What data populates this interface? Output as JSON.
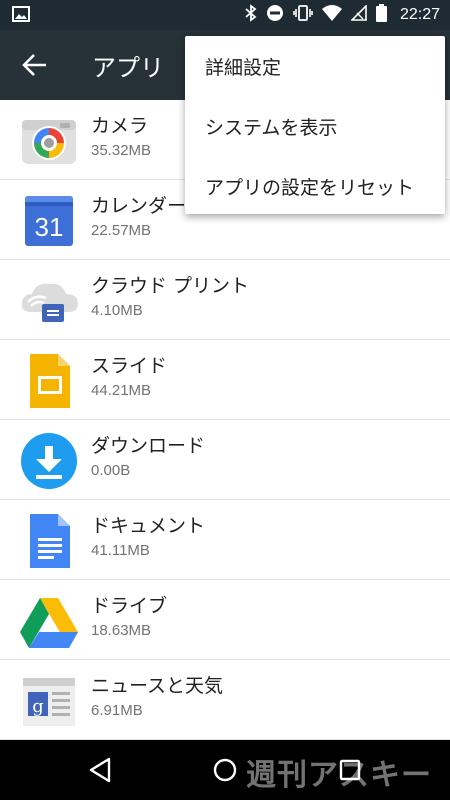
{
  "status_bar": {
    "time": "22:27"
  },
  "app_bar": {
    "title": "アプリ"
  },
  "apps": [
    {
      "name": "カメラ",
      "size": "35.32MB",
      "icon": "camera-icon"
    },
    {
      "name": "カレンダー",
      "size": "22.57MB",
      "icon": "calendar-icon",
      "icon_text": "31"
    },
    {
      "name": "クラウド プリント",
      "size": "4.10MB",
      "icon": "cloud-print-icon"
    },
    {
      "name": "スライド",
      "size": "44.21MB",
      "icon": "slides-icon"
    },
    {
      "name": "ダウンロード",
      "size": "0.00B",
      "icon": "download-icon"
    },
    {
      "name": "ドキュメント",
      "size": "41.11MB",
      "icon": "docs-icon"
    },
    {
      "name": "ドライブ",
      "size": "18.63MB",
      "icon": "drive-icon"
    },
    {
      "name": "ニュースと天気",
      "size": "6.91MB",
      "icon": "news-weather-icon"
    }
  ],
  "menu": {
    "items": [
      "詳細設定",
      "システムを表示",
      "アプリの設定をリセット"
    ]
  },
  "watermark": "週刊アスキー",
  "colors": {
    "status_bar": "#1f2b33",
    "app_bar": "#263238",
    "calendar_blue": "#3d6fd6",
    "slides_yellow": "#f4b400",
    "download_blue": "#1e9cf0",
    "docs_blue": "#4285f4"
  }
}
